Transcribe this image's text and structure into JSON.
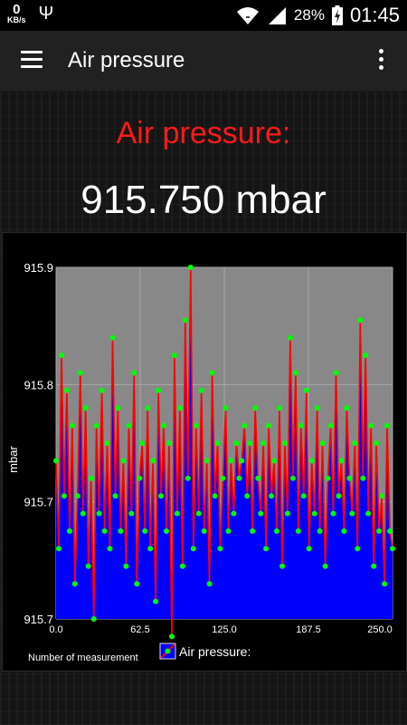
{
  "status_bar": {
    "speed_value": "0",
    "speed_unit": "KB/s",
    "usb_icon": "usb-icon",
    "wifi_icon": "wifi-icon",
    "signal_icon": "signal-icon",
    "battery_percent": "28%",
    "battery_icon": "battery-charging-icon",
    "time": "01:45"
  },
  "app_bar": {
    "menu_icon": "hamburger-menu-icon",
    "title": "Air pressure",
    "overflow_icon": "overflow-menu-icon"
  },
  "reading": {
    "label": "Air pressure:",
    "value": "915.750 mbar"
  },
  "colors": {
    "label": "#ff1a1a",
    "area_fill": "#0000ff",
    "line": "#ff0000",
    "points": "#00ff00",
    "plot_background": "#888888"
  },
  "chart_data": {
    "type": "area",
    "ylabel": "mbar",
    "xlabel": "Number of measurement",
    "legend": "Air pressure:",
    "legend_position": "bottom",
    "xlim": [
      0,
      250
    ],
    "ylim": [
      915.7,
      915.9
    ],
    "x_ticks": [
      "0.0",
      "62.5",
      "125.0",
      "187.5",
      "250.0"
    ],
    "y_ticks": [
      "915.9",
      "915.8",
      "915.7",
      "915.7"
    ],
    "grid": true,
    "series": [
      {
        "name": "Air pressure:",
        "x": [
          0,
          2,
          4,
          6,
          8,
          10,
          12,
          14,
          16,
          18,
          20,
          22,
          24,
          26,
          28,
          30,
          32,
          34,
          36,
          38,
          40,
          42,
          44,
          46,
          48,
          50,
          52,
          54,
          56,
          58,
          60,
          62,
          64,
          66,
          68,
          70,
          72,
          74,
          76,
          78,
          80,
          82,
          84,
          86,
          88,
          90,
          92,
          94,
          96,
          98,
          100,
          102,
          104,
          106,
          108,
          110,
          112,
          114,
          116,
          118,
          120,
          122,
          124,
          126,
          128,
          130,
          132,
          134,
          136,
          138,
          140,
          142,
          144,
          146,
          148,
          150,
          152,
          154,
          156,
          158,
          160,
          162,
          164,
          166,
          168,
          170,
          172,
          174,
          176,
          178,
          180,
          182,
          184,
          186,
          188,
          190,
          192,
          194,
          196,
          198,
          200,
          202,
          204,
          206,
          208,
          210,
          212,
          214,
          216,
          218,
          220,
          222,
          224,
          226,
          228,
          230,
          232,
          234,
          236,
          238,
          240,
          242,
          244,
          246,
          248,
          250
        ],
        "values": [
          915.79,
          915.74,
          915.85,
          915.77,
          915.83,
          915.75,
          915.81,
          915.72,
          915.77,
          915.84,
          915.76,
          915.82,
          915.73,
          915.78,
          915.7,
          915.81,
          915.76,
          915.83,
          915.75,
          915.8,
          915.74,
          915.86,
          915.77,
          915.82,
          915.75,
          915.79,
          915.73,
          915.81,
          915.76,
          915.84,
          915.72,
          915.78,
          915.8,
          915.75,
          915.82,
          915.74,
          915.79,
          915.71,
          915.83,
          915.77,
          915.81,
          915.75,
          915.8,
          915.69,
          915.85,
          915.76,
          915.82,
          915.73,
          915.87,
          915.78,
          915.9,
          915.74,
          915.81,
          915.76,
          915.83,
          915.75,
          915.79,
          915.72,
          915.84,
          915.77,
          915.8,
          915.74,
          915.78,
          915.82,
          915.75,
          915.79,
          915.76,
          915.8,
          915.78,
          915.79,
          915.81,
          915.77,
          915.8,
          915.75,
          915.82,
          915.78,
          915.76,
          915.8,
          915.74,
          915.81,
          915.77,
          915.79,
          915.75,
          915.82,
          915.73,
          915.8,
          915.76,
          915.86,
          915.78,
          915.84,
          915.75,
          915.81,
          915.77,
          915.83,
          915.74,
          915.79,
          915.76,
          915.82,
          915.75,
          915.8,
          915.73,
          915.78,
          915.81,
          915.76,
          915.84,
          915.77,
          915.79,
          915.75,
          915.82,
          915.78,
          915.76,
          915.8,
          915.74,
          915.87,
          915.78,
          915.85,
          915.76,
          915.81,
          915.73,
          915.8,
          915.75,
          915.77,
          915.72,
          915.81,
          915.75,
          915.74
        ]
      }
    ]
  }
}
